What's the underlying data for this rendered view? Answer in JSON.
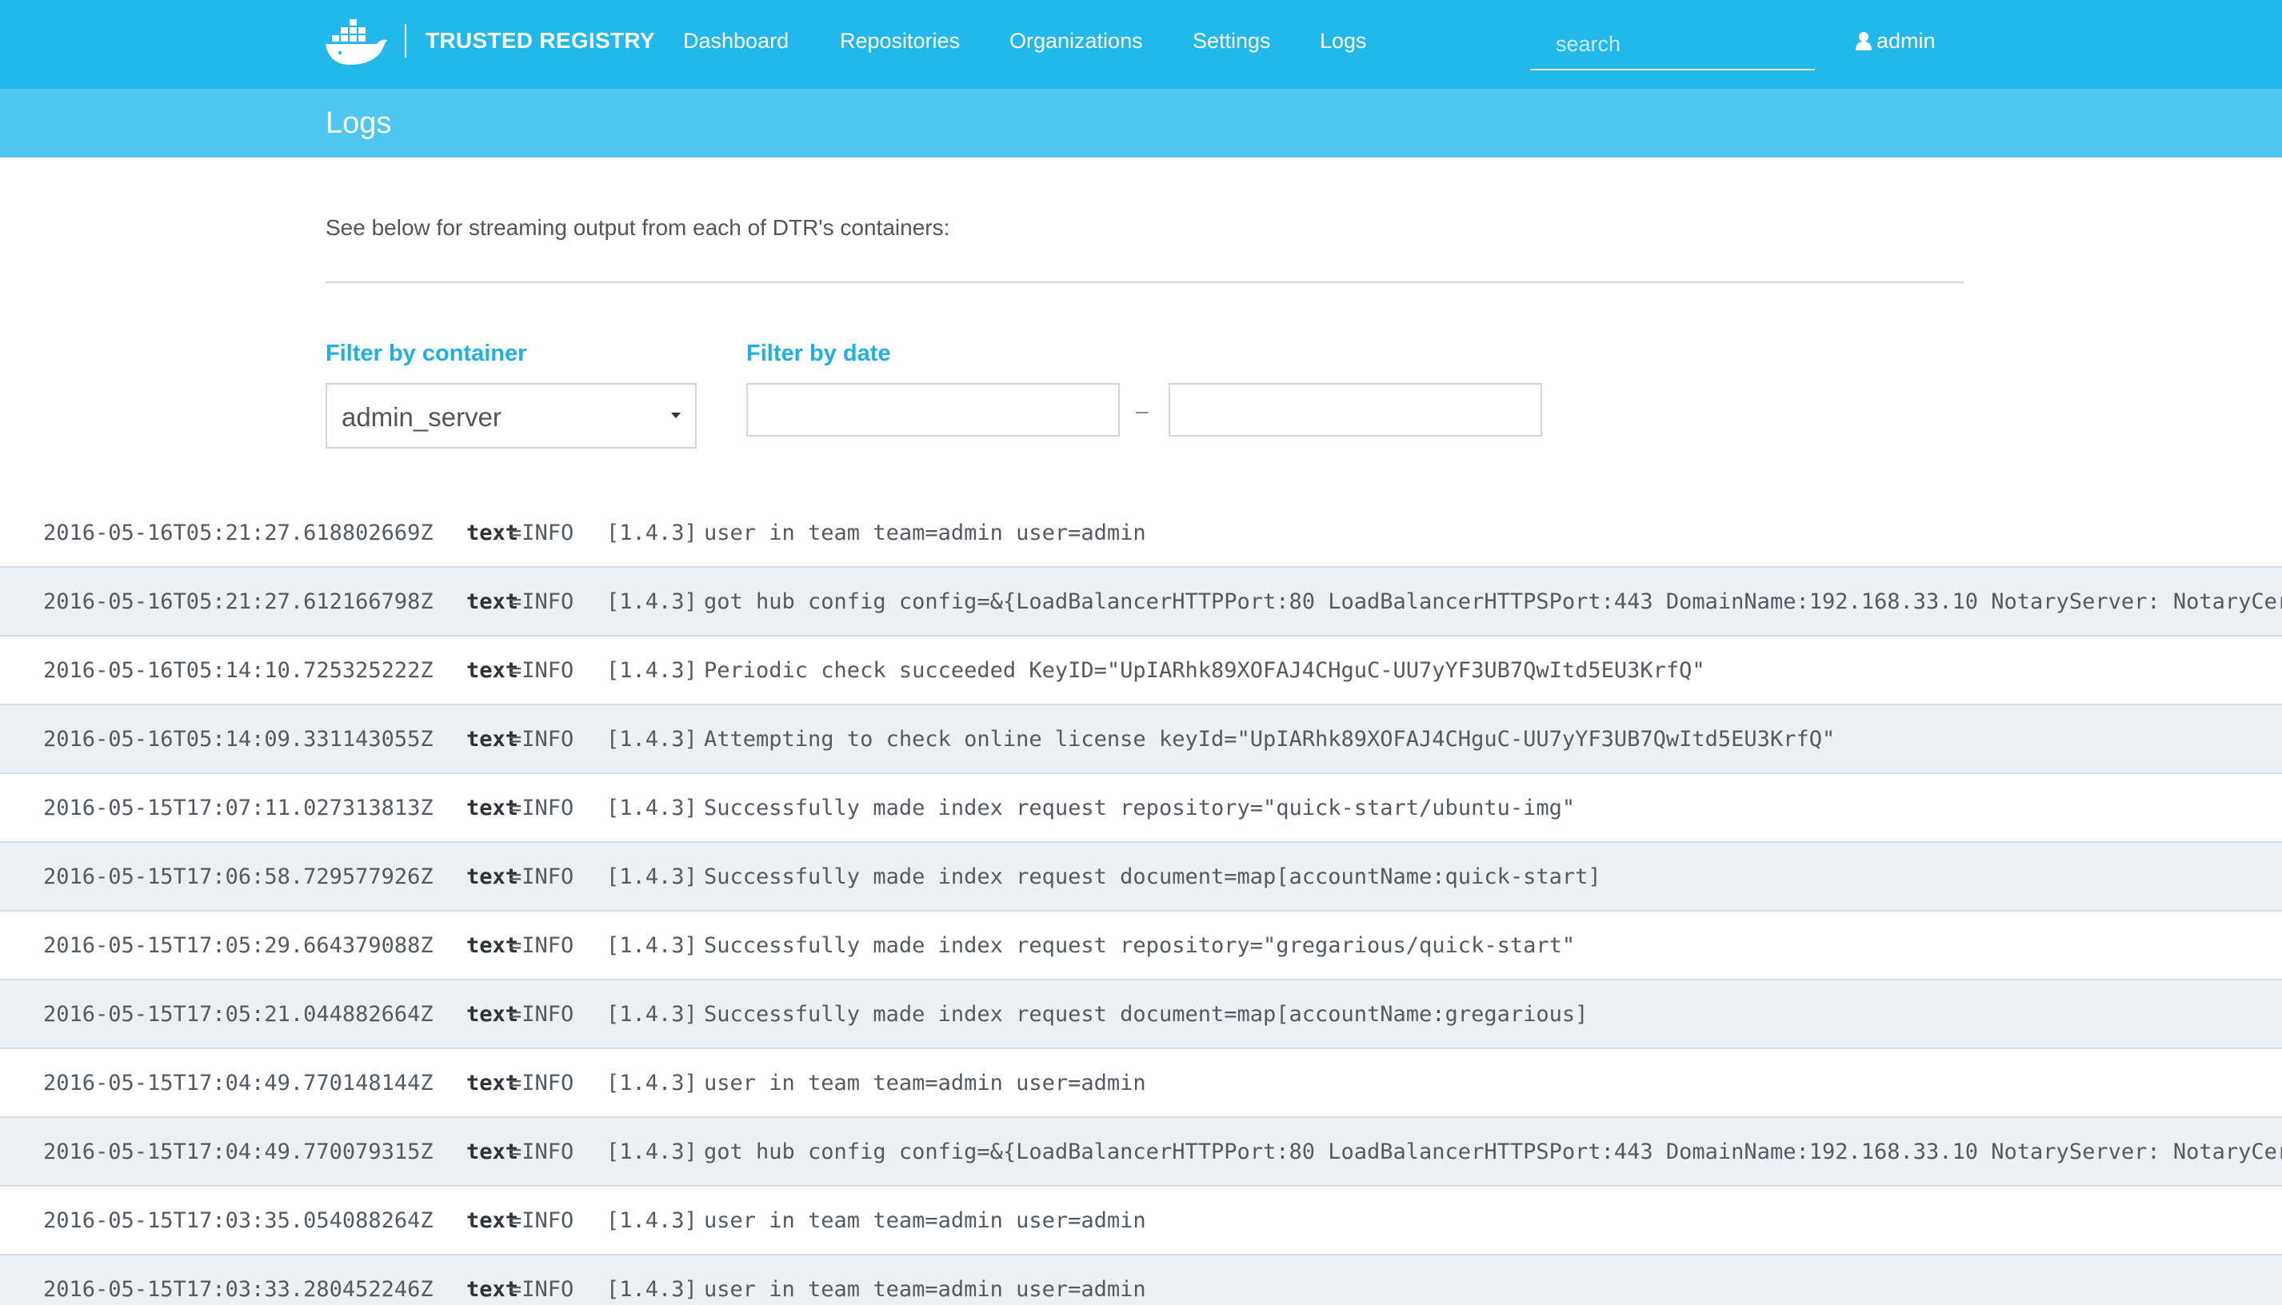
{
  "header": {
    "brand": "TRUSTED REGISTRY",
    "nav": [
      {
        "label": "Dashboard"
      },
      {
        "label": "Repositories"
      },
      {
        "label": "Organizations"
      },
      {
        "label": "Settings"
      },
      {
        "label": "Logs"
      }
    ],
    "search_placeholder": "search",
    "user": "admin",
    "icons": {
      "logo": "docker-whale-icon",
      "user": "user-icon"
    }
  },
  "page": {
    "title": "Logs",
    "intro": "See below for streaming output from each of DTR's containers:"
  },
  "filters": {
    "container_label": "Filter by container",
    "container_value": "admin_server",
    "date_label": "Filter by date",
    "date_from": "",
    "date_to": "",
    "date_separator": "–"
  },
  "logs": [
    {
      "timestamp": "2016-05-16T05:21:27.618802669Z",
      "key": "text",
      "level": "=INFO",
      "version": "[1.4.3]",
      "message": "user in team team=admin user=admin"
    },
    {
      "timestamp": "2016-05-16T05:21:27.612166798Z",
      "key": "text",
      "level": "=INFO",
      "version": "[1.4.3]",
      "message": "got hub config config=&{LoadBalancerHTTPPort:80 LoadBalancerHTTPSPort:443 DomainName:192.168.33.10 NotaryServer: NotaryCert: N"
    },
    {
      "timestamp": "2016-05-16T05:14:10.725325222Z",
      "key": "text",
      "level": "=INFO",
      "version": "[1.4.3]",
      "message": "Periodic check succeeded KeyID=\"UpIARhk89XOFAJ4CHguC-UU7yYF3UB7QwItd5EU3KrfQ\""
    },
    {
      "timestamp": "2016-05-16T05:14:09.331143055Z",
      "key": "text",
      "level": "=INFO",
      "version": "[1.4.3]",
      "message": "Attempting to check online license keyId=\"UpIARhk89XOFAJ4CHguC-UU7yYF3UB7QwItd5EU3KrfQ\""
    },
    {
      "timestamp": "2016-05-15T17:07:11.027313813Z",
      "key": "text",
      "level": "=INFO",
      "version": "[1.4.3]",
      "message": "Successfully made index request repository=\"quick-start/ubuntu-img\""
    },
    {
      "timestamp": "2016-05-15T17:06:58.729577926Z",
      "key": "text",
      "level": "=INFO",
      "version": "[1.4.3]",
      "message": "Successfully made index request document=map[accountName:quick-start]"
    },
    {
      "timestamp": "2016-05-15T17:05:29.664379088Z",
      "key": "text",
      "level": "=INFO",
      "version": "[1.4.3]",
      "message": "Successfully made index request repository=\"gregarious/quick-start\""
    },
    {
      "timestamp": "2016-05-15T17:05:21.044882664Z",
      "key": "text",
      "level": "=INFO",
      "version": "[1.4.3]",
      "message": "Successfully made index request document=map[accountName:gregarious]"
    },
    {
      "timestamp": "2016-05-15T17:04:49.770148144Z",
      "key": "text",
      "level": "=INFO",
      "version": "[1.4.3]",
      "message": "user in team team=admin user=admin"
    },
    {
      "timestamp": "2016-05-15T17:04:49.770079315Z",
      "key": "text",
      "level": "=INFO",
      "version": "[1.4.3]",
      "message": "got hub config config=&{LoadBalancerHTTPPort:80 LoadBalancerHTTPSPort:443 DomainName:192.168.33.10 NotaryServer: NotaryCert: N"
    },
    {
      "timestamp": "2016-05-15T17:03:35.054088264Z",
      "key": "text",
      "level": "=INFO",
      "version": "[1.4.3]",
      "message": "user in team team=admin user=admin"
    },
    {
      "timestamp": "2016-05-15T17:03:33.280452246Z",
      "key": "text",
      "level": "=INFO",
      "version": "[1.4.3]",
      "message": "user in team team=admin user=admin"
    }
  ],
  "colors": {
    "topbar": "#22b8eb",
    "subbar": "#4dc6f0",
    "accent": "#1fb0e6",
    "row_alt": "#ebf0f5"
  }
}
